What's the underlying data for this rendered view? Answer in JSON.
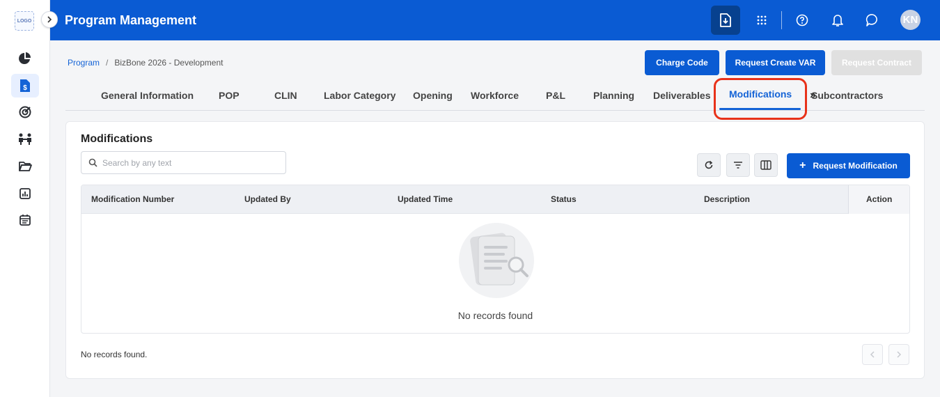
{
  "app": {
    "logo_text": "LOGO",
    "title": "Program Management",
    "avatar_initials": "KN"
  },
  "rail": {
    "icons": [
      "dashboard-pie-icon",
      "program-budget-icon",
      "target-icon",
      "people-icon",
      "folder-icon",
      "report-chart-icon",
      "calendar-icon"
    ]
  },
  "topbar": {
    "icons": [
      "download-icon",
      "apps-grid-icon",
      "help-icon",
      "bell-icon",
      "chat-icon"
    ]
  },
  "breadcrumb": {
    "root": "Program",
    "separator": "/",
    "current": "BizBone 2026 - Development"
  },
  "header_buttons": {
    "charge_code": "Charge Code",
    "request_create_var": "Request Create VAR",
    "request_contract": "Request Contract"
  },
  "tabs": [
    {
      "label": "General Information"
    },
    {
      "label": "POP"
    },
    {
      "label": "CLIN"
    },
    {
      "label": "Labor Category"
    },
    {
      "label": "Opening"
    },
    {
      "label": "Workforce"
    },
    {
      "label": "P&L"
    },
    {
      "label": "Planning"
    },
    {
      "label": "Deliverables"
    },
    {
      "label": "Modifications"
    },
    {
      "label": "Subcontractors"
    }
  ],
  "tabs_more": "»",
  "active_tab": "Modifications",
  "card": {
    "title": "Modifications",
    "search_placeholder": "Search by any text",
    "search_value": "",
    "request_modification_label": "Request Modification",
    "plus": "+"
  },
  "table": {
    "columns": [
      "Modification Number",
      "Updated By",
      "Updated Time",
      "Status",
      "Description",
      "Action"
    ],
    "rows": [],
    "empty_message": "No records found"
  },
  "footer": {
    "status": "No records found."
  },
  "colors": {
    "primary": "#0a5bd3",
    "highlight": "#e8321a"
  }
}
